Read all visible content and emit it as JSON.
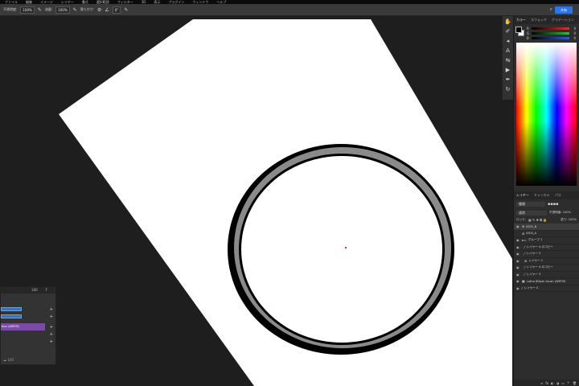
{
  "menu": [
    "ファイル",
    "編集",
    "イメージ",
    "レイヤー",
    "書式",
    "選択範囲",
    "フィルター",
    "3D",
    "表示",
    "プラグイン",
    "ウィンドウ",
    "ヘルプ"
  ],
  "options_bar": {
    "opacity_label": "不透明度:",
    "opacity_value": "100%",
    "flow_label": "流量:",
    "flow_value": "100%",
    "smoothing_label": "滑らかさ:",
    "angle_value": "0°",
    "share_label": "共有"
  },
  "tools": [
    "hand-icon",
    "brush-icon",
    "move-icon",
    "type-icon",
    "transform-icon",
    "play-icon",
    "pen-icon",
    "rotate-icon"
  ],
  "color_panel": {
    "tabs": [
      "カラー",
      "スウォッチ",
      "グラデーション"
    ],
    "channels": [
      {
        "label": "R",
        "value": "0",
        "color": "#c8302c"
      },
      {
        "label": "G",
        "value": "0",
        "color": "#2f9b39"
      },
      {
        "label": "B",
        "value": "0",
        "color": "#2c54c8"
      }
    ]
  },
  "layers_panel": {
    "tabs": [
      "レイヤー",
      "チャンネル",
      "パス"
    ],
    "kind_label": "種類",
    "blend_mode": "通常",
    "opacity": "不透明度: 100%",
    "fill": "塗り: 100%",
    "lock_label": "ロック:",
    "layers": [
      {
        "name": "KIOS_B",
        "selected": true
      },
      {
        "name": "KIOS_A",
        "selected": false
      },
      {
        "name": "グループ 1",
        "selected": false
      },
      {
        "name": "レイヤー 4 のコピー",
        "selected": false
      },
      {
        "name": "レイヤー 2",
        "selected": false
      },
      {
        "name": "レイヤー 1",
        "selected": false
      },
      {
        "name": "レイヤー 4 のコピー",
        "selected": false
      },
      {
        "name": "レイヤー 3",
        "selected": false
      },
      {
        "name": "Lotha 60lpm brush (WEFM)",
        "selected": false
      },
      {
        "name": "レイヤー 0",
        "selected": false
      }
    ]
  },
  "float_panel": {
    "header": "100",
    "item": "tion (WEFM)",
    "footer": "100"
  },
  "canvas": {
    "dark_bg": "#1e1e1e",
    "paper": "#ffffff",
    "ring_outer": "#000000",
    "ring_fill": "#8a8a8a"
  }
}
